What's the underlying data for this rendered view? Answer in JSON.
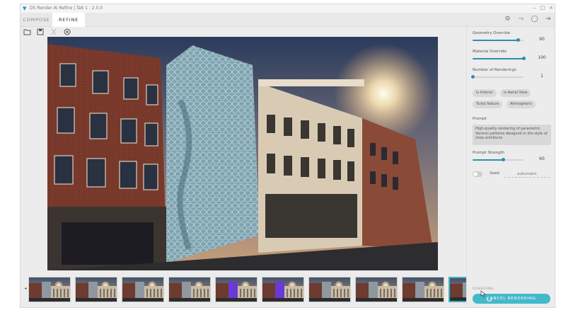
{
  "window": {
    "title": "D5 Render AI Refine | Tab 1 : 2.0.0",
    "controls": [
      "–",
      "□",
      "×"
    ]
  },
  "tabs": [
    {
      "label": "COMPOSE",
      "active": false
    },
    {
      "label": "REFINE",
      "active": true
    }
  ],
  "top_icons": [
    "gear-icon",
    "share-icon",
    "chat-icon",
    "logout-icon"
  ],
  "toolbar": {
    "open_icon": "folder-icon",
    "save_icon": "save-icon",
    "crop_icon": "crop-icon",
    "close_icon": "circle-x-icon"
  },
  "thumbnails": [
    {
      "variant": "warm",
      "selected": false
    },
    {
      "variant": "warm",
      "selected": false
    },
    {
      "variant": "warm",
      "selected": false
    },
    {
      "variant": "warm",
      "selected": false
    },
    {
      "variant": "purple",
      "selected": false
    },
    {
      "variant": "purple",
      "selected": false
    },
    {
      "variant": "warm",
      "selected": false
    },
    {
      "variant": "warm",
      "selected": false
    },
    {
      "variant": "warm",
      "selected": false
    },
    {
      "variant": "warm",
      "selected": true
    }
  ],
  "thumb_nav": {
    "left": "◂",
    "right": "▸"
  },
  "panel": {
    "geometry_override": {
      "label": "Geometry Override",
      "value": "90",
      "fraction": 0.9
    },
    "material_override": {
      "label": "Material Override",
      "value": "100",
      "fraction": 1.0
    },
    "number_of_renderings": {
      "label": "Number of Renderings",
      "value": "1",
      "fraction": 0.0
    },
    "chips": [
      "Is Interior",
      "Is Aerial View",
      "Turbo Nature",
      "Atmospheric"
    ],
    "prompt": {
      "label": "Prompt",
      "text": "High-quality rendering of parametric Voronoi patterns designed in the style of shop architects"
    },
    "prompt_strength": {
      "label": "Prompt Strength",
      "value": "60",
      "fraction": 0.6
    },
    "seed": {
      "label": "Seed",
      "value": "automatic",
      "enabled": false
    },
    "footer_note": "RENDERING…",
    "cancel_label": "CANCEL RENDERING"
  },
  "colors": {
    "accent": "#43b9cb",
    "slider": "#2f8fb0",
    "panel_bg": "#ececec"
  }
}
